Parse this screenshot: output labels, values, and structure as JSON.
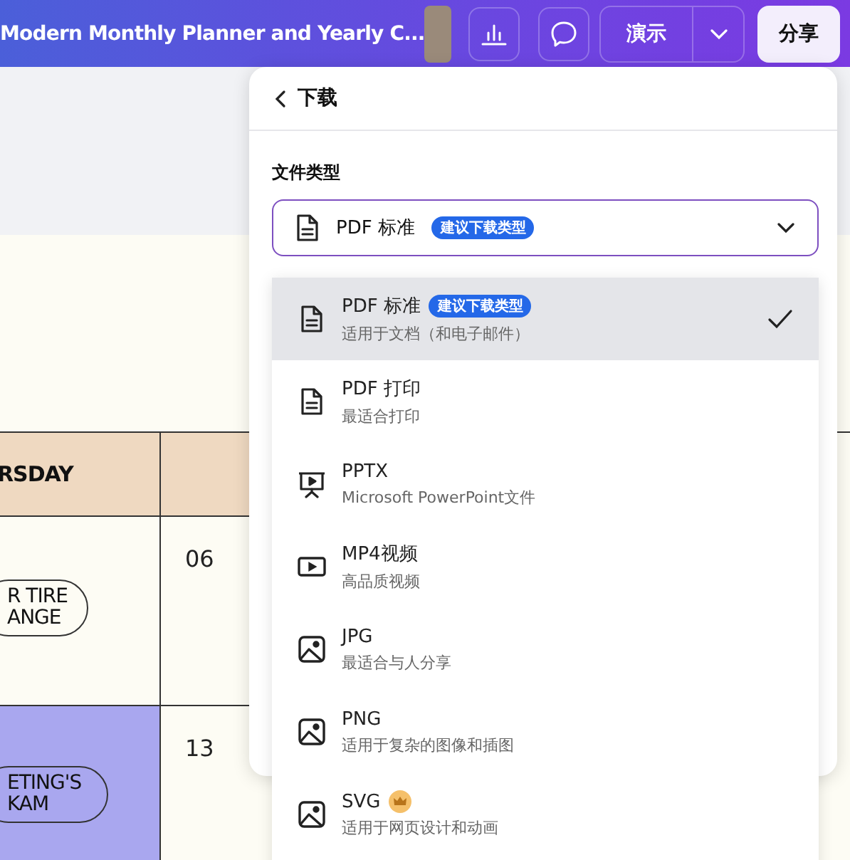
{
  "topbar": {
    "title": "Modern Monthly Planner and Yearly C...",
    "present_button": "演示",
    "share_button": "分享"
  },
  "calendar": {
    "day_label": "RSDAY",
    "rows": [
      {
        "event": [
          "R TIRE",
          "ANGE"
        ],
        "date": "06",
        "highlighted": false
      },
      {
        "event": [
          "ETING'S",
          "KAM"
        ],
        "date": "13",
        "highlighted": true
      }
    ]
  },
  "download_panel": {
    "title": "下载",
    "file_type_label": "文件类型",
    "select": {
      "value": "PDF 标准",
      "badge": "建议下载类型"
    },
    "options": [
      {
        "kind": "document",
        "name": "PDF 标准",
        "badge": "建议下载类型",
        "description": "适用于文档（和电子邮件）",
        "premium": false,
        "selected": true
      },
      {
        "kind": "document",
        "name": "PDF 打印",
        "description": "最适合打印",
        "premium": false,
        "selected": false
      },
      {
        "kind": "presentation",
        "name": "PPTX",
        "description": "Microsoft PowerPoint文件",
        "premium": false,
        "selected": false
      },
      {
        "kind": "video",
        "name": "MP4视频",
        "description": "高品质视频",
        "premium": false,
        "selected": false
      },
      {
        "kind": "image",
        "name": "JPG",
        "description": "最适合与人分享",
        "premium": false,
        "selected": false
      },
      {
        "kind": "image",
        "name": "PNG",
        "description": "适用于复杂的图像和插图",
        "premium": false,
        "selected": false
      },
      {
        "kind": "image",
        "name": "SVG",
        "description": "适用于网页设计和动画",
        "premium": true,
        "selected": false
      }
    ]
  }
}
